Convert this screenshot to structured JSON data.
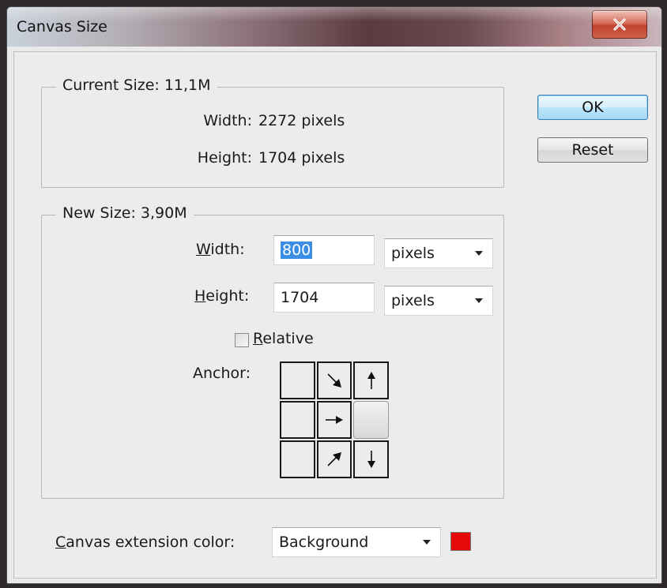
{
  "window": {
    "title": "Canvas Size"
  },
  "buttons": {
    "ok": "OK",
    "reset": "Reset"
  },
  "current_size": {
    "label": "Current Size: 11,1M",
    "width_label": "Width:",
    "width_value": "2272 pixels",
    "height_label": "Height:",
    "height_value": "1704 pixels"
  },
  "new_size": {
    "label": "New Size: 3,90M",
    "width_label_accel": "W",
    "width_label_rest": "idth:",
    "width_value": "800",
    "width_unit": "pixels",
    "height_label_accel": "H",
    "height_label_rest": "eight:",
    "height_value": "1704",
    "height_unit": "pixels",
    "relative_accel": "R",
    "relative_rest": "elative",
    "relative_checked": false,
    "anchor_label": "Anchor:",
    "anchor_selected": "middle-right"
  },
  "extension": {
    "label_accel": "C",
    "label_rest": "anvas extension color:",
    "value": "Background",
    "swatch_color": "#e8090d"
  },
  "colors": {
    "accent": "#3a8ee6"
  }
}
